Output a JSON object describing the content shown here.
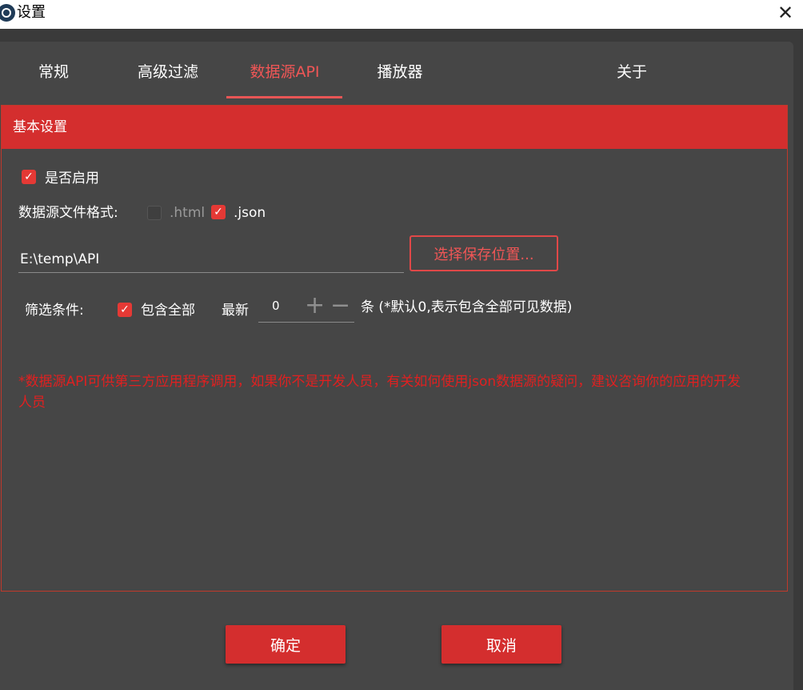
{
  "window": {
    "title": "设置",
    "close_glyph": "✕"
  },
  "tabs": [
    {
      "label": "常规",
      "active": false
    },
    {
      "label": "高级过滤",
      "active": false
    },
    {
      "label": "数据源API",
      "active": true
    },
    {
      "label": "播放器",
      "active": false
    },
    {
      "label": "关于",
      "active": false
    }
  ],
  "group": {
    "title": "基本设置"
  },
  "enable": {
    "label": "是否启用",
    "checked": true
  },
  "format": {
    "label": "数据源文件格式:",
    "html": {
      "label": ".html",
      "checked": false
    },
    "json": {
      "label": ".json",
      "checked": true
    }
  },
  "save_path": {
    "value": "E:\\temp\\API",
    "button_label": "选择保存位置..."
  },
  "filter": {
    "label": "筛选条件:",
    "include_all": {
      "label": "包含全部",
      "checked": true
    },
    "latest_label": "最新",
    "latest_value": "0",
    "unit_note": "条 (*默认0,表示包含全部可见数据)"
  },
  "notice": "*数据源API可供第三方应用程序调用，如果你不是开发人员，有关如何使用json数据源的疑问，建议咨询你的应用的开发人员",
  "buttons": {
    "ok": "确定",
    "cancel": "取消"
  },
  "colors": {
    "accent": "#d42e2e",
    "tab_active": "#f05656",
    "notice": "#e02020",
    "panel": "#464646"
  }
}
